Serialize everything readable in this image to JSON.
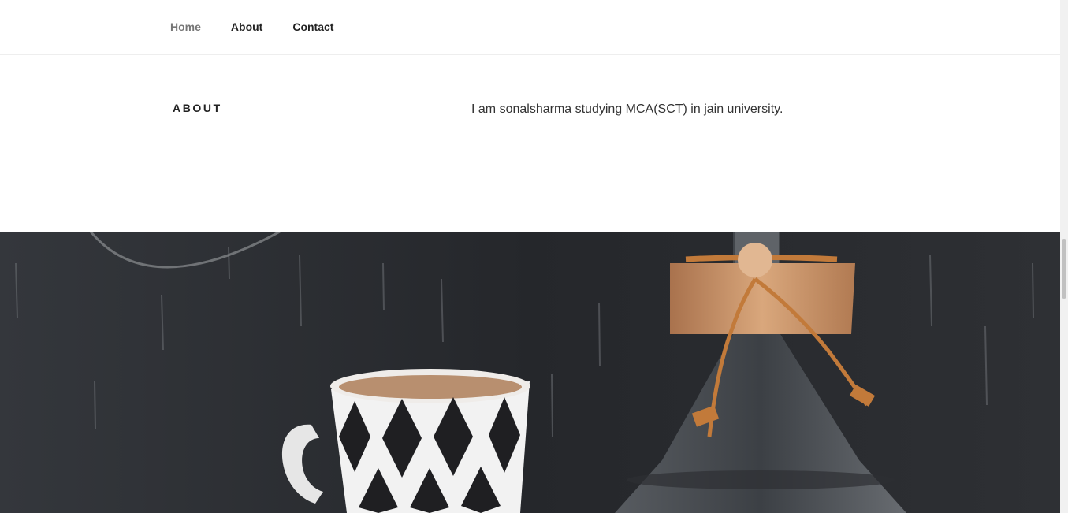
{
  "nav": {
    "items": [
      {
        "label": "Home",
        "current": true
      },
      {
        "label": "About",
        "current": false
      },
      {
        "label": "Contact",
        "current": false
      }
    ]
  },
  "about": {
    "title": "About",
    "text": "I am sonalsharma studying MCA(SCT) in jain university."
  },
  "colors": {
    "nav_current": "#767676",
    "nav_text": "#222222",
    "panel_background": "#2b2d31",
    "chemex_strap": "#c27a3a",
    "chemex_wood": "#c9946a"
  },
  "panel": {
    "image_icon": "coffee-cup-chemex-image"
  }
}
